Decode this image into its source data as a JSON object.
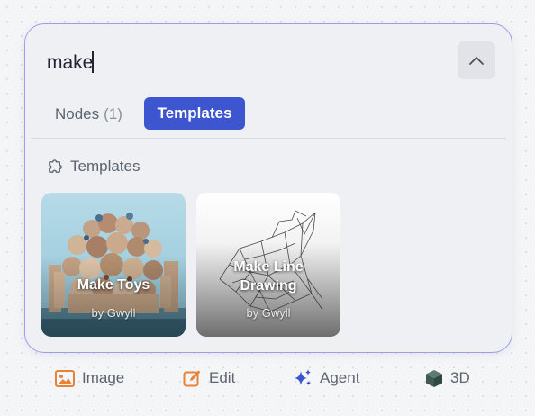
{
  "search": {
    "value": "make"
  },
  "tabs": {
    "nodes_label": "Nodes",
    "nodes_count": "(1)",
    "templates_label": "Templates"
  },
  "section": {
    "title": "Templates"
  },
  "templates": [
    {
      "title": "Make Toys",
      "author": "by Gwyll"
    },
    {
      "title": "Make Line Drawing",
      "author": "by Gwyll"
    }
  ],
  "toolbar": {
    "image_label": "Image",
    "edit_label": "Edit",
    "agent_label": "Agent",
    "three_d_label": "3D"
  },
  "colors": {
    "accent": "#3d55cf",
    "panel_border": "#9aa0e8",
    "image_icon": "#e8813a",
    "edit_icon": "#e8813a",
    "agent_icon": "#3d55cf",
    "three_d_icon": "#3e5a52"
  },
  "icons": {
    "collapse": "chevron-up-icon",
    "section": "puzzle-icon",
    "image": "image-icon",
    "edit": "edit-icon",
    "agent": "sparkles-icon",
    "three_d": "cube-icon"
  }
}
